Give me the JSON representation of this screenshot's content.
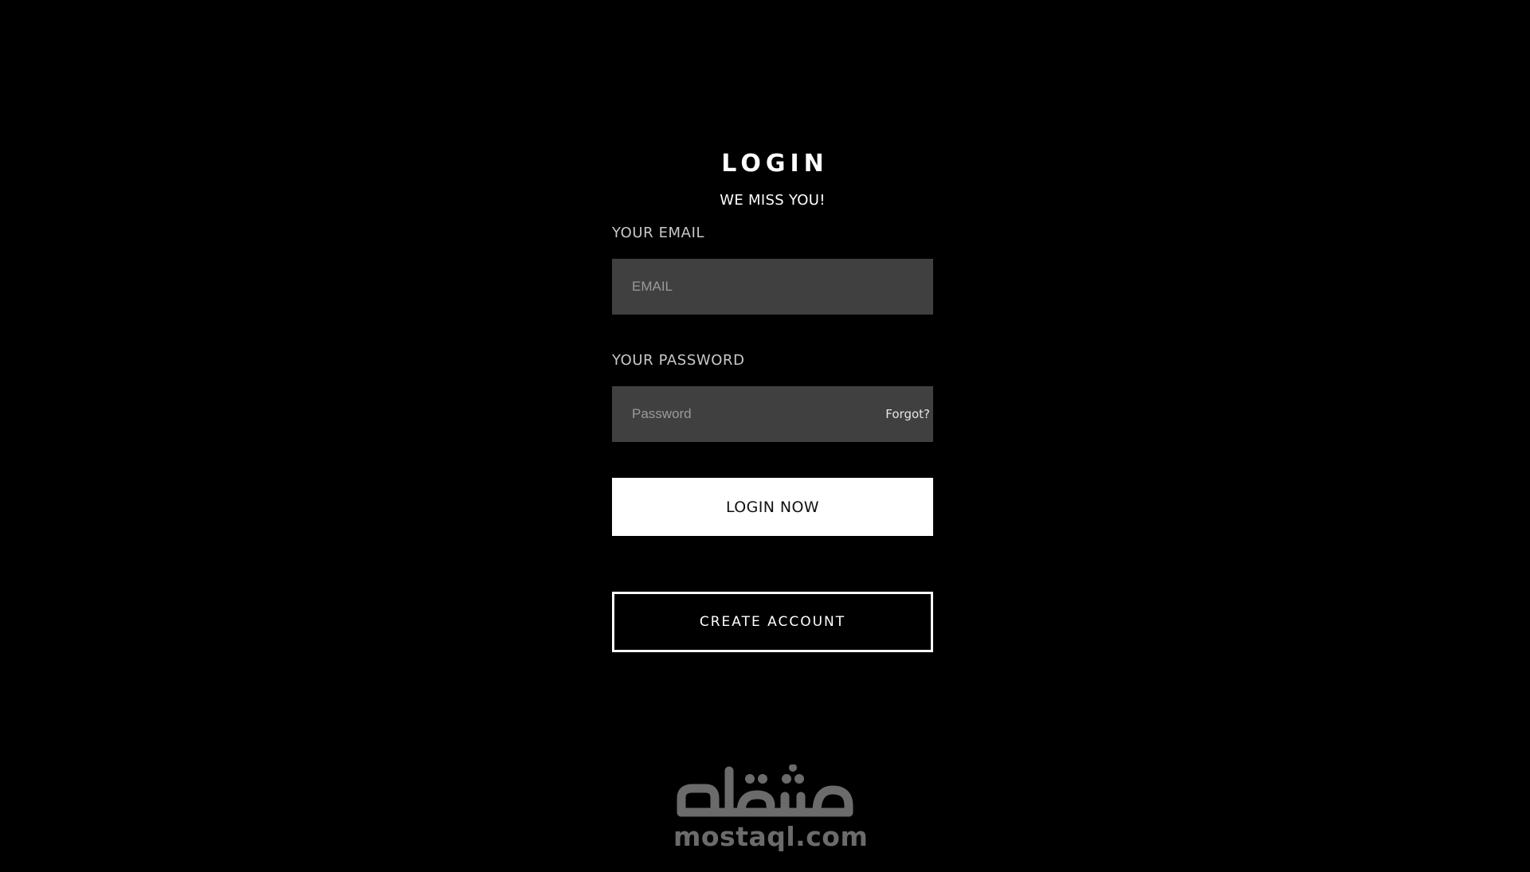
{
  "login": {
    "title": "LOGIN",
    "subtitle": "WE MISS YOU!",
    "email_label": "YOUR EMAIL",
    "email_placeholder": "EMAIL",
    "email_value": "",
    "password_label": "YOUR PASSWORD",
    "password_placeholder": "Password",
    "password_value": "",
    "forgot_label": "Forgot?",
    "login_button_label": "LOGIN NOW",
    "create_account_label": "CREATE ACCOUNT"
  },
  "watermark": {
    "logo_arabic": "مستقل",
    "site_text": "mostaql.com"
  },
  "colors": {
    "background": "#000000",
    "input_background": "#404040",
    "label_text": "#c8c8c8",
    "primary_button_bg": "#ffffff",
    "primary_button_text": "#111111"
  }
}
